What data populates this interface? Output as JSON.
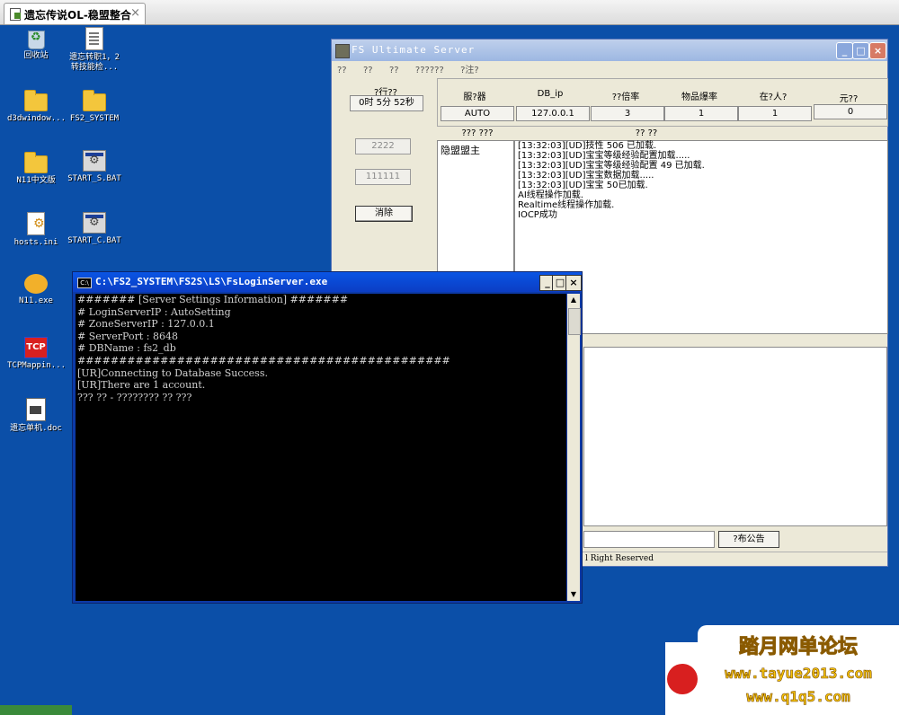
{
  "browser_tab": {
    "title": "遗忘传说OL-稳盟整合",
    "close": "×"
  },
  "desktop_icons": [
    {
      "label": "回收站",
      "icon": "recycle-bin-icon"
    },
    {
      "label": "遗忘转职1，2\n转技能检...",
      "icon": "document-icon"
    },
    {
      "label": "d3dwindow...",
      "icon": "folder-icon"
    },
    {
      "label": "FS2_SYSTEM",
      "icon": "folder-icon"
    },
    {
      "label": "N11中文版",
      "icon": "folder-icon"
    },
    {
      "label": "START_S.BAT",
      "icon": "batch-file-icon"
    },
    {
      "label": "hosts.ini",
      "icon": "ini-file-icon"
    },
    {
      "label": "START_C.BAT",
      "icon": "batch-file-icon"
    },
    {
      "label": "N11.exe",
      "icon": "n11-app-icon"
    },
    {
      "label": "TCPMappin...",
      "icon": "tcp-mapping-icon"
    },
    {
      "label": "遗忘单机.doc",
      "icon": "word-document-icon"
    }
  ],
  "fs_server": {
    "title": "FS Ultimate Server",
    "menu": "??  ??  ??  ??????  ?注?",
    "runtime_label": "?行??",
    "runtime_value": "0时 5分 52秒",
    "headers": [
      "服?器",
      "DB_ip",
      "??倍率",
      "物品爆率",
      "在?人?",
      "元??"
    ],
    "values": [
      "AUTO",
      "127.0.0.1",
      "3",
      "1",
      "1",
      "0"
    ],
    "panel_header_1": "??? ???",
    "panel_header_2": "?? ??",
    "input_1": "2222",
    "input_2": "111111",
    "clear_button": "消除",
    "list_item": "隐盟盟主",
    "log_lines": [
      "[13:32:03][UD]技性 506 已加载.",
      "[13:32:03][UD]宝宝等级经验配置加载.....",
      "[13:32:03][UD]宝宝等级经验配置 49 已加载.",
      "[13:32:03][UD]宝宝数据加载.....",
      "[13:32:03][UD]宝宝 50已加载.",
      "AI线程操作加载.",
      "Realtime线程操作加载.",
      "IOCP成功"
    ],
    "broadcast_button": "?布公告",
    "status_text": "l Right Reserved"
  },
  "console": {
    "title": "C:\\FS2_SYSTEM\\FS2S\\LS\\FsLoginServer.exe",
    "lines": [
      "####### [Server Settings Information] #######",
      "# LoginServerIP : AutoSetting",
      "# ZoneServerIP : 127.0.0.1",
      "# ServerPort : 8648",
      "# DBName : fs2_db",
      "#############################################",
      "[UR]Connecting to Database Success.",
      "[UR]There are 1 account.",
      "??? ?? - ???????? ?? ???"
    ]
  },
  "watermark": {
    "line1": "踏月网单论坛",
    "line2": "www.tayue2013.com",
    "line3": "www.q1q5.com"
  }
}
